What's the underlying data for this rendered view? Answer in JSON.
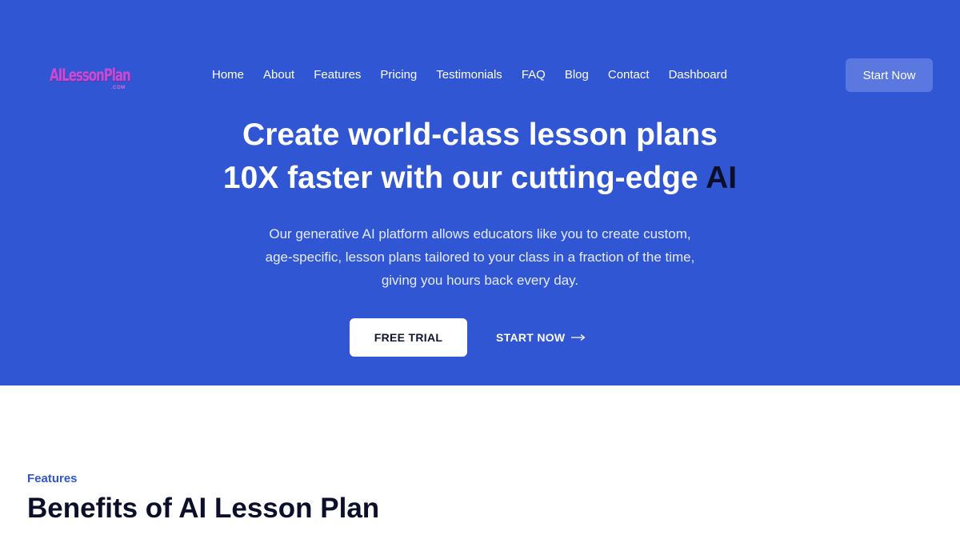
{
  "brand": {
    "logo_text": "AILessonPlan",
    "logo_sub": ".COM",
    "logo_color": "#c44dd8"
  },
  "nav": {
    "items": [
      {
        "label": "Home"
      },
      {
        "label": "About"
      },
      {
        "label": "Features"
      },
      {
        "label": "Pricing"
      },
      {
        "label": "Testimonials"
      },
      {
        "label": "FAQ"
      },
      {
        "label": "Blog"
      },
      {
        "label": "Contact"
      },
      {
        "label": "Dashboard"
      }
    ],
    "cta_label": "Start Now"
  },
  "hero": {
    "headline_line1": "Create world-class lesson plans",
    "headline_line2": "10X faster with our cutting-edge",
    "headline_highlight": "AI",
    "description": "Our generative AI platform allows educators like you to create custom, age-specific, lesson plans tailored to your class in a fraction of the time, giving you hours back every day.",
    "primary_cta": "FREE TRIAL",
    "secondary_cta": "START NOW",
    "secondary_cta_icon": "arrow-right-icon",
    "background_color": "#3056d3"
  },
  "features_section": {
    "eyebrow": "Features",
    "title": "Benefits of AI Lesson Plan"
  }
}
